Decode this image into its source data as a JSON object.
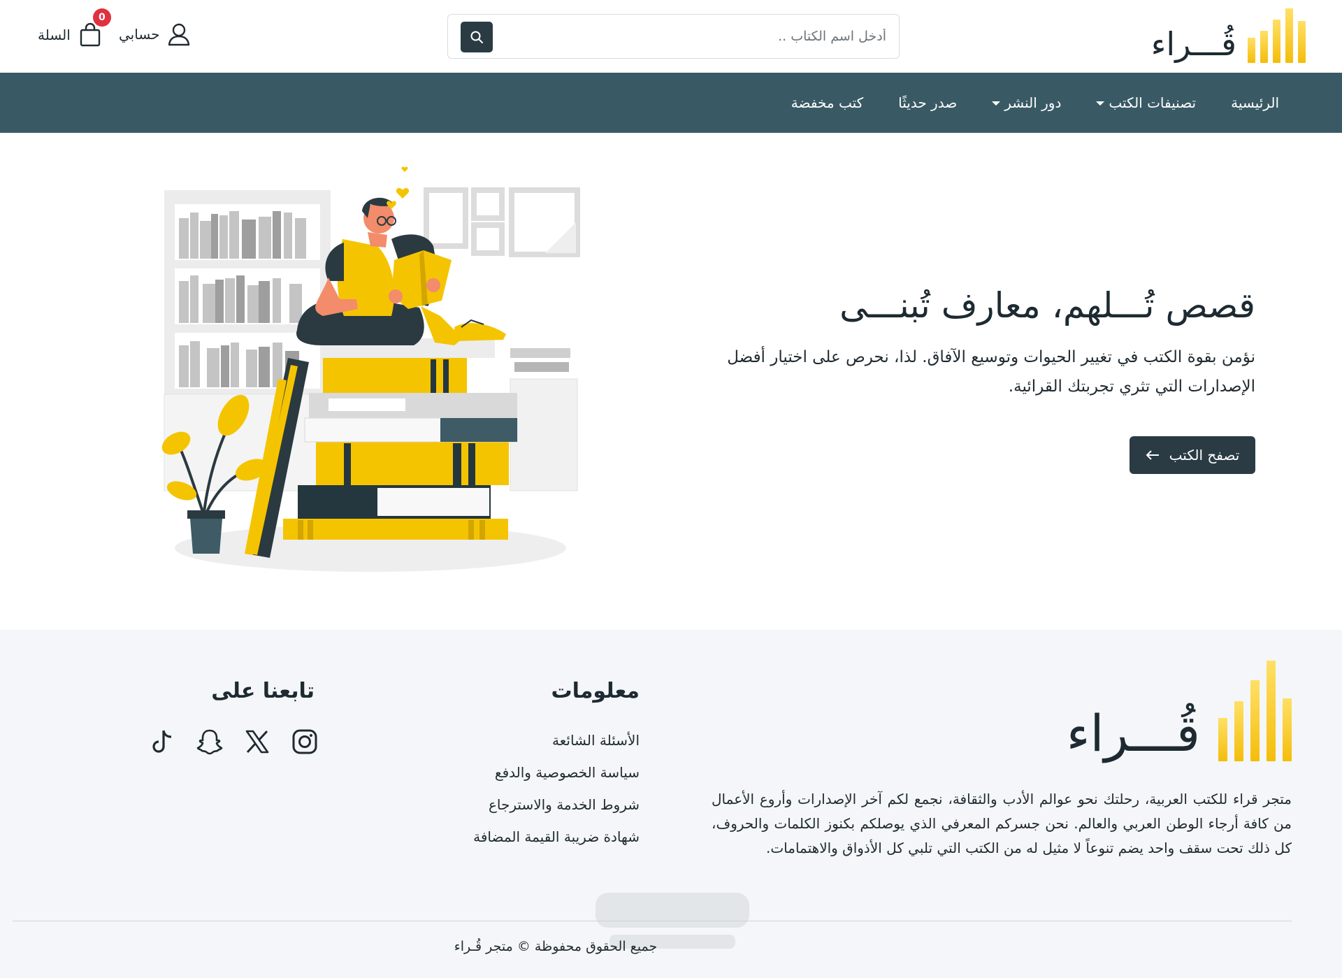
{
  "brand": {
    "name": "قُـــراء",
    "accent": "#f4bd0b"
  },
  "header": {
    "search_placeholder": "أدخل اسم الكتاب ..",
    "account_label": "حسابي",
    "cart_label": "السلة",
    "cart_count": "0"
  },
  "nav": {
    "items": [
      {
        "label": "الرئيسية"
      },
      {
        "label": "تصنيفات الكتب"
      },
      {
        "label": "دور النشر"
      },
      {
        "label": "صدر حديثًا"
      },
      {
        "label": "كتب مخفضة"
      }
    ],
    "bg": "#395a65"
  },
  "hero": {
    "title": "قصص تُـــلهم، معارف تُبنـــى",
    "subtitle": "نؤمن بقوة الكتب في تغيير الحيوات وتوسيع الآفاق. لذا، نحرص على اختيار أفضل الإصدارات التي تثري تجربتك القرائية.",
    "cta_label": "تصفح الكتب"
  },
  "footer": {
    "about": "متجر قراء للكتب العربية، رحلتك نحو عوالم الأدب والثقافة، نجمع لكم آخر الإصدارات وأروع الأعمال من كافة أرجاء الوطن العربي والعالم. نحن جسركم المعرفي الذي يوصلكم بكنوز الكلمات والحروف، كل ذلك تحت سقف واحد يضم تنوعاً لا مثيل له من الكتب التي تلبي كل الأذواق والاهتمامات.",
    "info_heading": "معلومات",
    "info_links": [
      {
        "label": "الأسئلة الشائعة"
      },
      {
        "label": "سياسة الخصوصية والدفع"
      },
      {
        "label": "شروط الخدمة والاسترجاع"
      },
      {
        "label": "شهادة ضريبة القيمة المضافة"
      }
    ],
    "follow_heading": "تابعنا على",
    "socials": [
      "instagram-icon",
      "x-icon",
      "snapchat-icon",
      "tiktok-icon"
    ],
    "copyright": "جميع الحقوق محفوظة © متجر قُـراء"
  }
}
